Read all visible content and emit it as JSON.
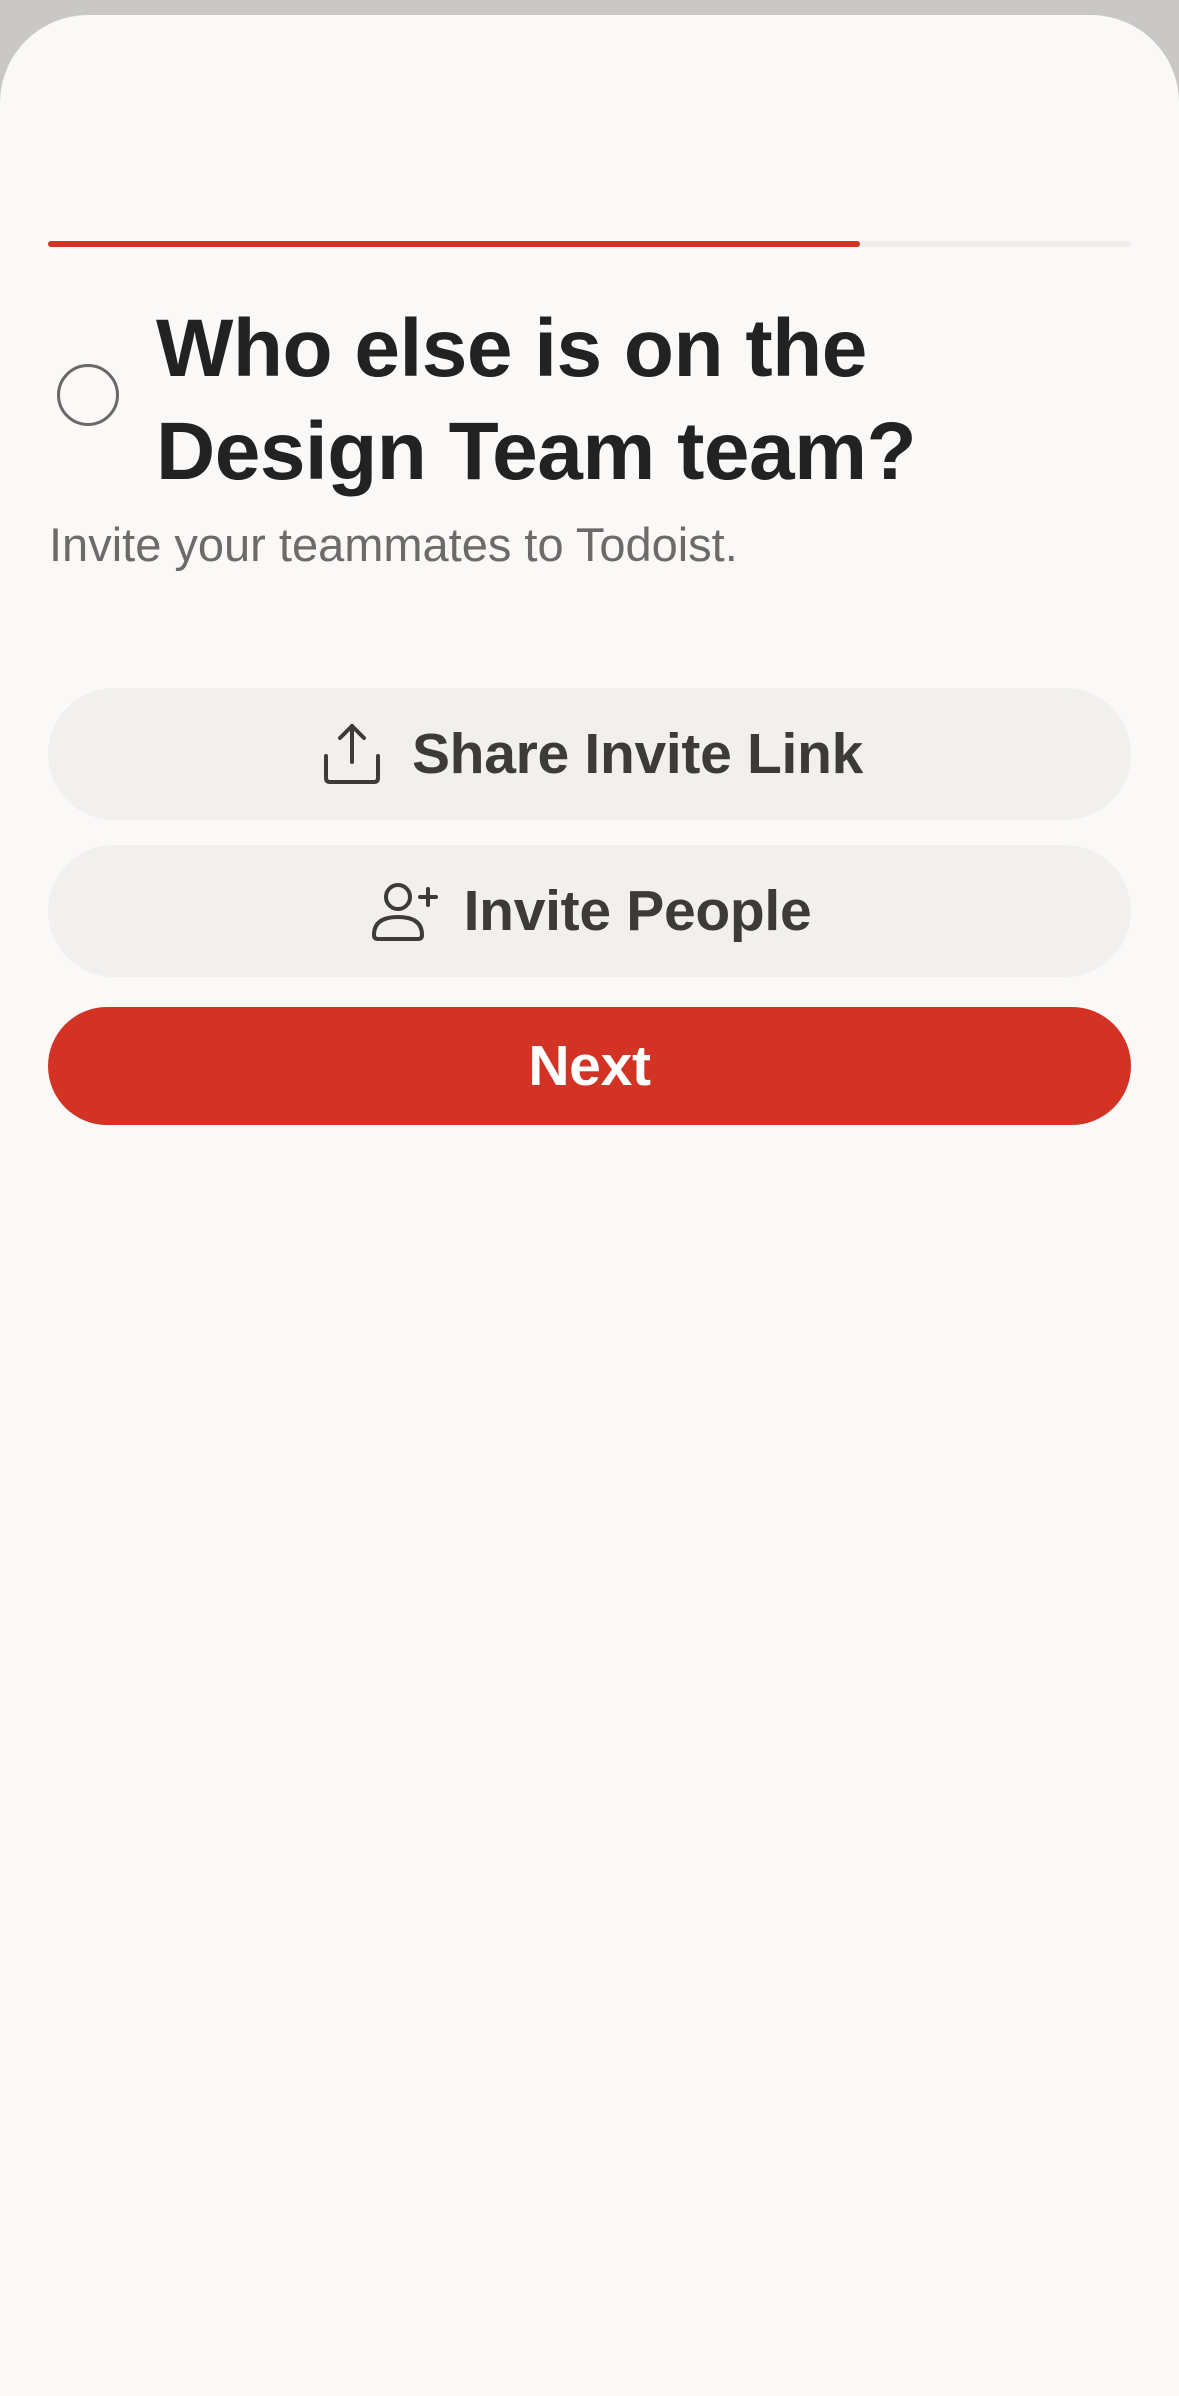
{
  "progress": {
    "fraction": 0.75
  },
  "header": {
    "title": "Who else is on the Design Team team?",
    "subtitle": "Invite your teammates to Todoist."
  },
  "actions": {
    "share_link_label": "Share Invite Link",
    "share_link_icon": "share-upload-icon",
    "invite_people_label": "Invite People",
    "invite_people_icon": "add-person-icon",
    "next_label": "Next"
  },
  "colors": {
    "accent": "#d33324",
    "background": "#faf9f8",
    "secondary_button": "#f1f0ee",
    "text_primary": "#222222",
    "text_secondary": "#6d6b69"
  }
}
